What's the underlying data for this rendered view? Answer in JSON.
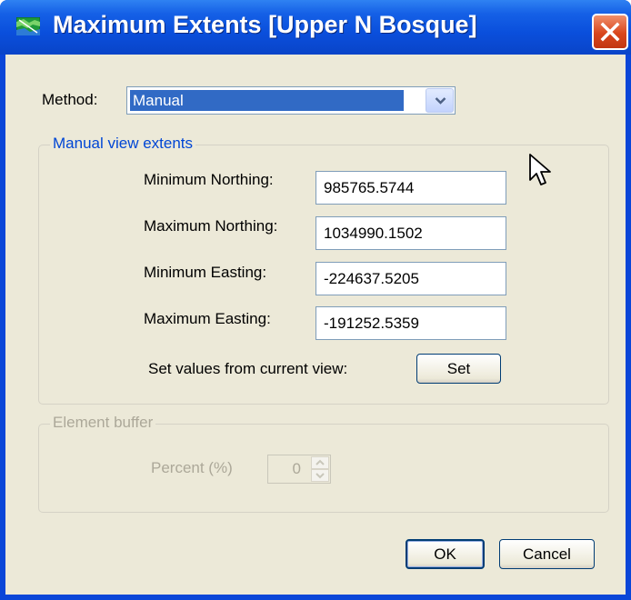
{
  "window": {
    "title": "Maximum Extents [Upper N Bosque]",
    "app_icon": "map-icon",
    "close_icon": "close-icon"
  },
  "method": {
    "label": "Method:",
    "selected": "Manual"
  },
  "manual_extents": {
    "legend": "Manual view extents",
    "fields": [
      {
        "label": "Minimum Northing:",
        "value": "985765.5744"
      },
      {
        "label": "Maximum Northing:",
        "value": "1034990.1502"
      },
      {
        "label": "Minimum Easting:",
        "value": "-224637.5205"
      },
      {
        "label": "Maximum Easting:",
        "value": "-191252.5359"
      }
    ],
    "set_prompt": "Set values from current view:",
    "set_button": "Set"
  },
  "element_buffer": {
    "legend": "Element buffer",
    "percent_label": "Percent (%)",
    "percent_value": "0"
  },
  "buttons": {
    "ok": "OK",
    "cancel": "Cancel"
  },
  "colors": {
    "titlebar": "#0a4fdc",
    "dialog_bg": "#ece9d8",
    "group_legend": "#0046d5",
    "disabled_text": "#aca899",
    "selection": "#316ac5",
    "close_button": "#d9471d"
  }
}
